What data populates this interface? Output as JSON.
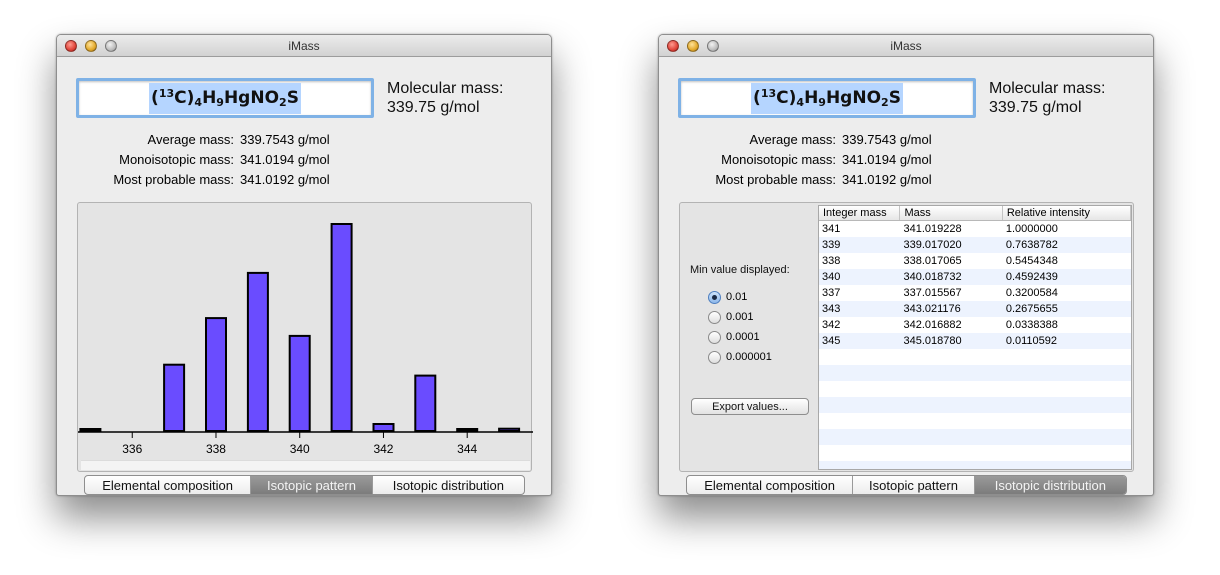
{
  "windows": {
    "left": {
      "title": "iMass",
      "formula": {
        "paren_open": "(",
        "isotope": "13",
        "element": "C",
        "close": ")",
        "n1": "4",
        "h": "H",
        "n2": "9",
        "rest": "HgNO",
        "n3": "2",
        "tail": "S"
      },
      "molecular_mass_label": "Molecular mass:",
      "molecular_mass_value": "339.75 g/mol",
      "average_label": "Average mass:",
      "average_value": "339.7543 g/mol",
      "mono_label": "Monoisotopic mass:",
      "mono_value": "341.0194 g/mol",
      "probable_label": "Most probable mass:",
      "probable_value": "341.0192 g/mol",
      "tabs": [
        "Elemental composition",
        "Isotopic pattern",
        "Isotopic distribution"
      ],
      "active_tab": 1
    },
    "right": {
      "title": "iMass",
      "formula": {
        "paren_open": "(",
        "isotope": "13",
        "element": "C",
        "close": ")",
        "n1": "4",
        "h": "H",
        "n2": "9",
        "rest": "HgNO",
        "n3": "2",
        "tail": "S"
      },
      "molecular_mass_label": "Molecular mass:",
      "molecular_mass_value": "339.75 g/mol",
      "average_label": "Average mass:",
      "average_value": "339.7543 g/mol",
      "mono_label": "Monoisotopic mass:",
      "mono_value": "341.0194 g/mol",
      "probable_label": "Most probable mass:",
      "probable_value": "341.0192 g/mol",
      "min_value_label": "Min value displayed:",
      "radio_options": [
        "0.01",
        "0.001",
        "0.0001",
        "0.000001"
      ],
      "radio_selected": 0,
      "export_label": "Export values...",
      "table_headers": [
        "Integer mass",
        "Mass",
        "Relative intensity"
      ],
      "table_rows": [
        [
          "341",
          "341.019228",
          "1.0000000"
        ],
        [
          "339",
          "339.017020",
          "0.7638782"
        ],
        [
          "338",
          "338.017065",
          "0.5454348"
        ],
        [
          "340",
          "340.018732",
          "0.4592439"
        ],
        [
          "337",
          "337.015567",
          "0.3200584"
        ],
        [
          "343",
          "343.021176",
          "0.2675655"
        ],
        [
          "342",
          "342.016882",
          "0.0338388"
        ],
        [
          "345",
          "345.018780",
          "0.0110592"
        ]
      ],
      "tabs": [
        "Elemental composition",
        "Isotopic pattern",
        "Isotopic distribution"
      ],
      "active_tab": 2
    }
  },
  "chart_data": {
    "type": "bar",
    "x": [
      335,
      337,
      338,
      339,
      340,
      341,
      342,
      343,
      344,
      345
    ],
    "values": [
      0.005,
      0.3200584,
      0.5454348,
      0.7638782,
      0.4592439,
      1.0,
      0.0338388,
      0.2675655,
      0.003,
      0.0110592
    ],
    "xticks": [
      "336",
      "338",
      "340",
      "342",
      "344"
    ],
    "xlim": [
      334.8,
      345.5
    ],
    "ylim": [
      0,
      1
    ],
    "bar_color": "#6a4cff",
    "grid": false
  }
}
